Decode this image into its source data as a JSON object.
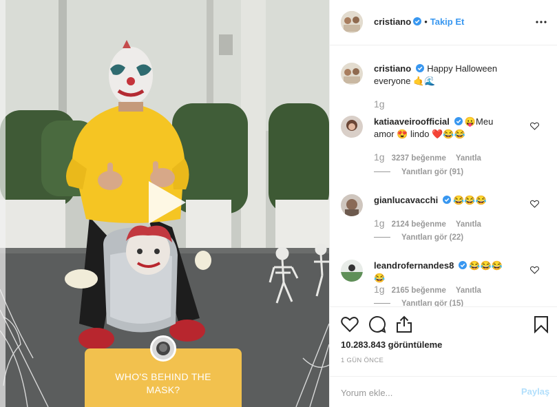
{
  "post": {
    "author": "cristiano",
    "follow_label": "Takip Et",
    "dot": "•"
  },
  "caption": {
    "username": "cristiano",
    "text": "Happy Halloween everyone 🤙🌊",
    "time": "1g"
  },
  "comments": [
    {
      "username": "katiaaveiroofficial",
      "text": "😛Meu amor 😍 lindo ❤️😂😂",
      "time": "1g",
      "likes": "3237 beğenme",
      "reply": "Yanıtla",
      "view_replies": "Yanıtları gör (91)"
    },
    {
      "username": "gianlucavacchi",
      "text": "😂😂😂",
      "time": "1g",
      "likes": "2124 beğenme",
      "reply": "Yanıtla",
      "view_replies": "Yanıtları gör (22)"
    },
    {
      "username": "leandrofernandes8",
      "text": "😂😂😂😂",
      "time": "1g",
      "likes": "2165 beğenme",
      "reply": "Yanıtla",
      "view_replies": "Yanıtları gör (15)"
    }
  ],
  "stats": {
    "views": "10.283.843 görüntüleme",
    "date": "1 GÜN ÖNCE"
  },
  "comment_box": {
    "placeholder": "Yorum ekle...",
    "share_label": "Paylaş"
  },
  "video": {
    "sticker_line1": "WHO'S BEHIND THE",
    "sticker_line2": "MASK?"
  },
  "colors": {
    "accent": "#3897f0",
    "verified": "#3897f0",
    "sticker": "#f2c14e",
    "hoodie": "#f5c523"
  }
}
